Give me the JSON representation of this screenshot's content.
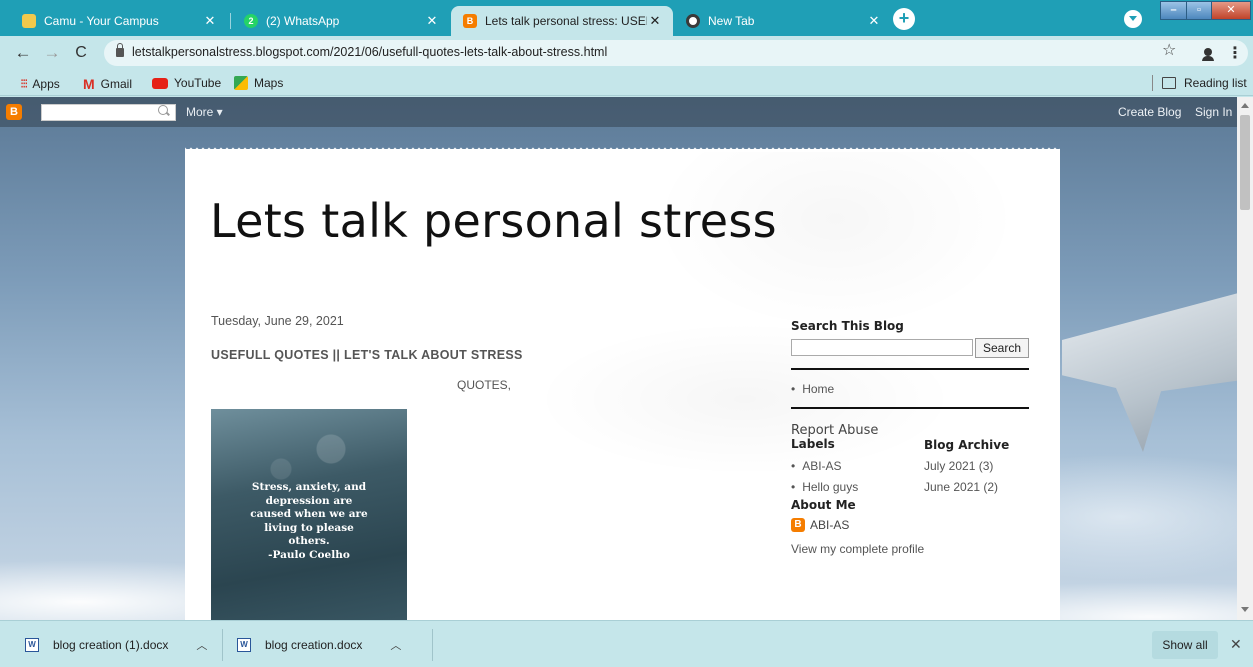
{
  "tabs": [
    {
      "title": "Camu - Your Campus",
      "favicon": "camu-icon",
      "active": false
    },
    {
      "title": "(2) WhatsApp",
      "favicon": "whatsapp-icon",
      "badge": "2",
      "active": false
    },
    {
      "title": "Lets talk personal stress: USEFUL",
      "favicon": "blogger-icon",
      "badge": "B",
      "active": true
    },
    {
      "title": "New Tab",
      "favicon": "chrome-icon",
      "active": false
    }
  ],
  "toolbar": {
    "url": "letstalkpersonalstress.blogspot.com/2021/06/usefull-quotes-lets-talk-about-stress.html"
  },
  "bookmarks": {
    "items": [
      {
        "label": "Apps",
        "icon": "apps-grid-icon"
      },
      {
        "label": "Gmail",
        "icon": "gmail-icon"
      },
      {
        "label": "YouTube",
        "icon": "youtube-icon"
      },
      {
        "label": "Maps",
        "icon": "maps-icon"
      }
    ],
    "reading_list": "Reading list"
  },
  "blogger_bar": {
    "logo": "B",
    "more_label": "More ▾",
    "create_blog": "Create Blog",
    "sign_in": "Sign In"
  },
  "blog": {
    "title": "Lets talk personal stress",
    "post_date": "Tuesday, June 29, 2021",
    "post_title": "USEFULL QUOTES || LET'S TALK ABOUT STRESS",
    "post_subtitle": "QUOTES,",
    "quote_lines": [
      "Stress, anxiety, and",
      "depression are",
      "caused when we are",
      "living to please",
      "others."
    ],
    "quote_author": "-Paulo Coelho"
  },
  "sidebar": {
    "search_heading": "Search This Blog",
    "search_button": "Search",
    "pages": [
      "Home"
    ],
    "report_abuse": "Report Abuse",
    "labels_heading": "Labels",
    "labels": [
      "ABI-AS",
      "Hello guys"
    ],
    "archive_heading": "Blog Archive",
    "archive": [
      "July 2021 (3)",
      "June 2021 (2)"
    ],
    "about_heading": "About Me",
    "profile_name": "ABI-AS",
    "profile_link": "View my complete profile"
  },
  "downloads": {
    "items": [
      {
        "name": "blog creation (1).docx"
      },
      {
        "name": "blog creation.docx"
      }
    ],
    "show_all": "Show all"
  },
  "colors": {
    "tabstrip": "#1f9fb6",
    "chrome_bg": "#c5e6ea",
    "blogger_orange": "#f57d00"
  }
}
